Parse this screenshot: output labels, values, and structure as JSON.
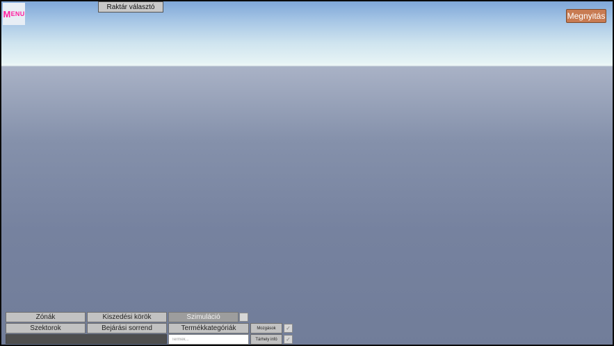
{
  "menu": {
    "label_first": "M",
    "label_rest": "enu"
  },
  "header": {
    "warehouse_selector": "Raktár választó",
    "open_button": "Megnyitás"
  },
  "panel": {
    "row1": [
      "Zónák",
      "Kiszedési körök",
      "Szimuláció"
    ],
    "row2": [
      "Szektorok",
      "Bejárási sorrend",
      "Termékkategóriák",
      "Mozgások"
    ],
    "row3": {
      "search_placeholder": "Termék...",
      "info_button": "Tárhely infó"
    },
    "check_mark": "✓",
    "selected": "Szimuláció"
  },
  "colors": {
    "menu_text": "#ff1ea0",
    "open_button_bg": "#c87b52",
    "button_bg": "#c2c2c2",
    "selected_bg": "#9d9d9d"
  }
}
